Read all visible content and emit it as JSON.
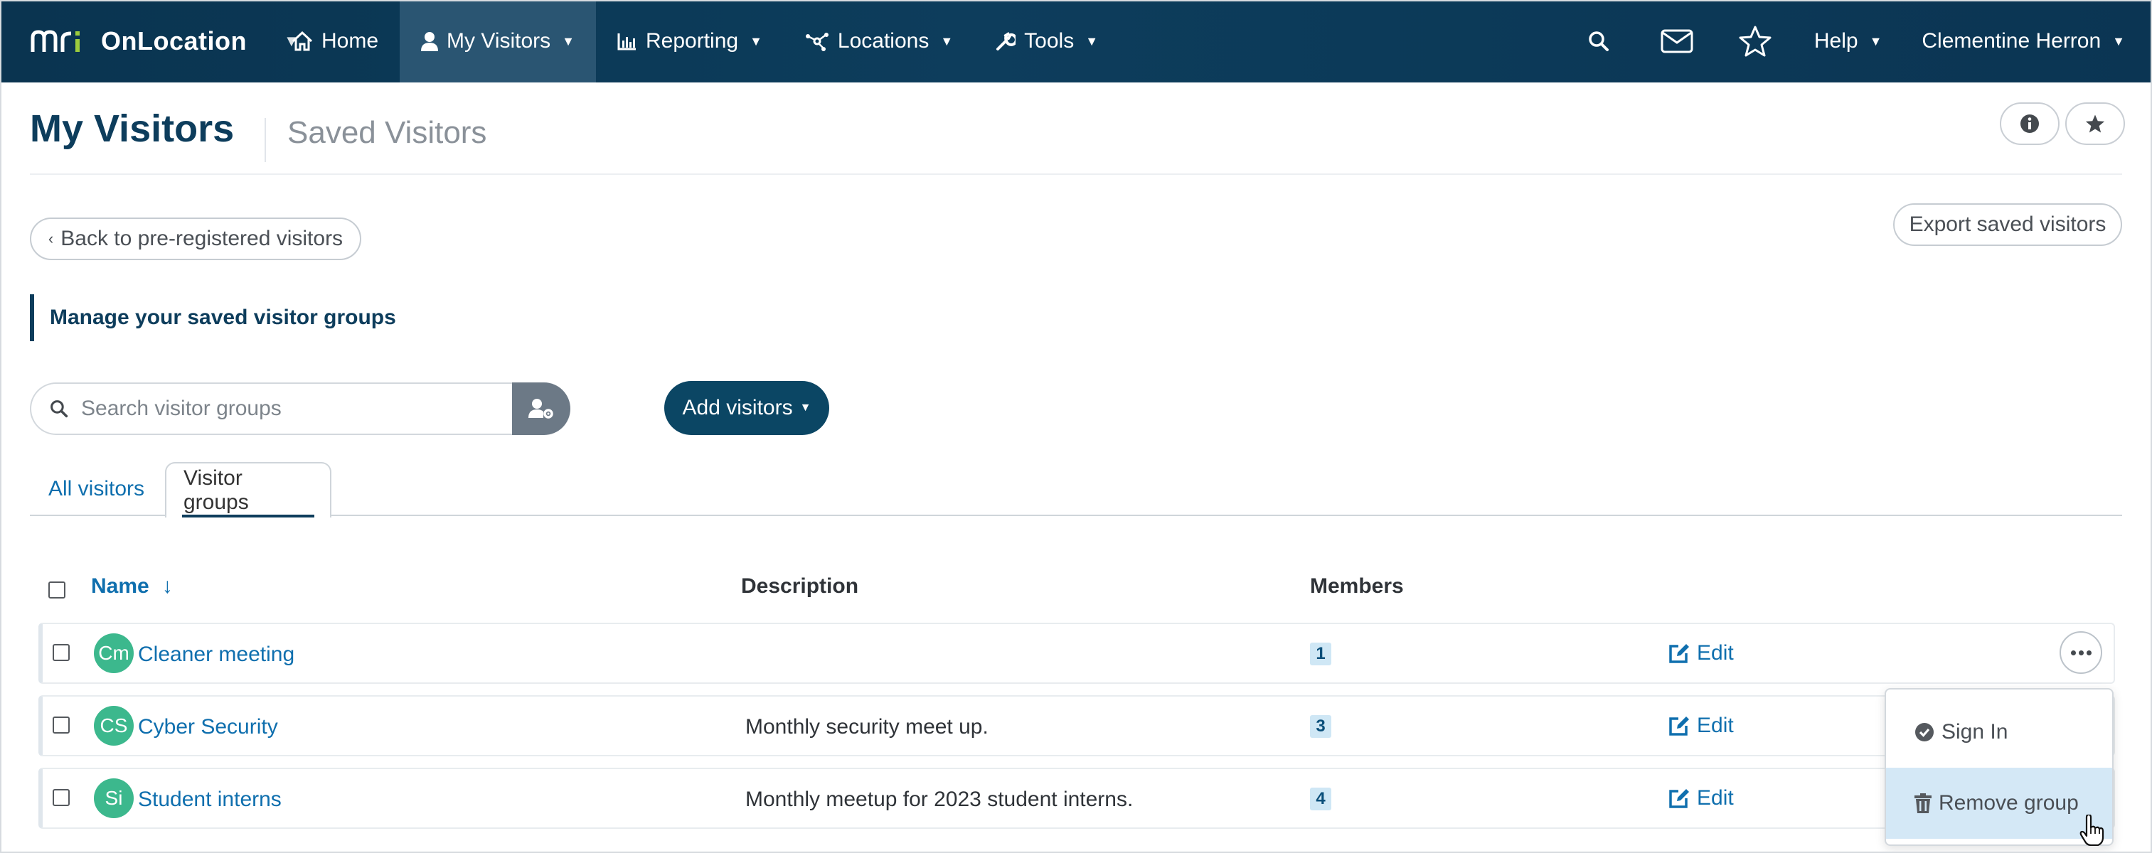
{
  "navbar": {
    "brand": "OnLocation",
    "items": [
      {
        "label": "Home",
        "icon": "home-icon"
      },
      {
        "label": "My Visitors",
        "icon": "user-icon",
        "active": true
      },
      {
        "label": "Reporting",
        "icon": "chart-icon"
      },
      {
        "label": "Locations",
        "icon": "locations-icon"
      },
      {
        "label": "Tools",
        "icon": "wrench-icon"
      }
    ],
    "help": "Help",
    "user": "Clementine Herron"
  },
  "page": {
    "title": "My Visitors",
    "subtitle": "Saved Visitors"
  },
  "actions": {
    "back": "Back to pre-registered visitors",
    "export": "Export saved visitors"
  },
  "section_label": "Manage your saved visitor groups",
  "search": {
    "placeholder": "Search visitor groups",
    "value": ""
  },
  "add_button": "Add visitors",
  "tabs": [
    {
      "label": "All visitors",
      "active": false
    },
    {
      "label": "Visitor groups",
      "active": true
    }
  ],
  "table": {
    "columns": {
      "name": "Name",
      "sort_indicator": "↓",
      "description": "Description",
      "members": "Members"
    },
    "rows": [
      {
        "initials": "Cm",
        "name": "Cleaner meeting",
        "description": "",
        "members": "1",
        "edit": "Edit"
      },
      {
        "initials": "CS",
        "name": "Cyber Security",
        "description": "Monthly security meet up.",
        "members": "3",
        "edit": "Edit"
      },
      {
        "initials": "Si",
        "name": "Student interns",
        "description": "Monthly meetup for 2023 student interns.",
        "members": "4",
        "edit": "Edit"
      }
    ]
  },
  "dropdown": {
    "sign_in": "Sign In",
    "remove": "Remove group"
  },
  "colors": {
    "navbar": "#0d3d5c",
    "accent": "#0f6fae",
    "avatar": "#3cb88d",
    "badge": "#cfe7f5",
    "dropdown_highlight": "#d4e8f6"
  }
}
